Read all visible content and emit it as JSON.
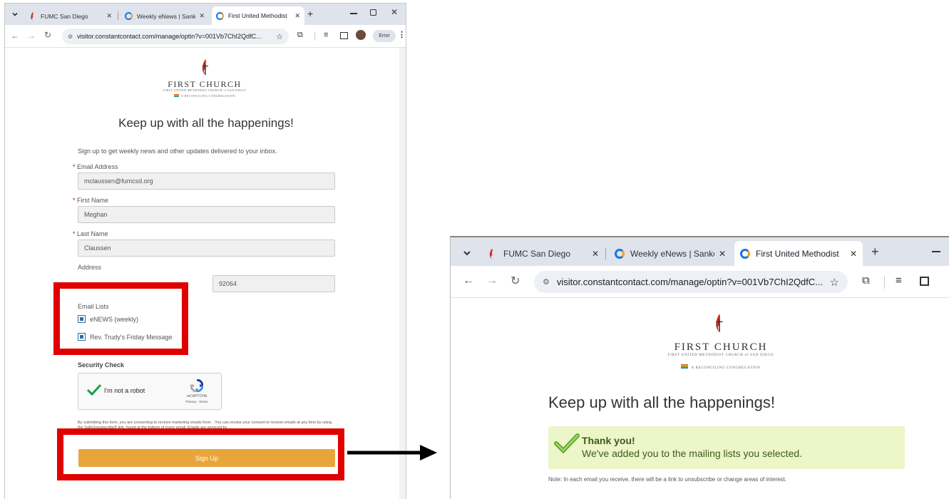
{
  "left_window": {
    "tabs": [
      {
        "title": "FUMC San Diego",
        "active": false
      },
      {
        "title": "Weekly eNews | Sankof",
        "active": false
      },
      {
        "title": "First United Methodist",
        "active": true
      }
    ],
    "new_tab": "+",
    "url": "visitor.constantcontact.com/manage/optin?v=001Vb7ChI2QdfC...",
    "error_badge": "Error",
    "logo": {
      "name": "FIRST CHURCH",
      "sub": "FIRST UNITED METHODIST CHURCH of SAN DIEGO",
      "tagline": "A RECONCILING CONGREGATION"
    },
    "heading": "Keep up with all the happenings!",
    "intro": "Sign up to get weekly news and other updates delivered to your inbox.",
    "fields": {
      "email": {
        "label": "Email Address",
        "value": "mclaussen@fumcsd.org"
      },
      "first_name": {
        "label": "First Name",
        "value": "Meghan"
      },
      "last_name": {
        "label": "Last Name",
        "value": "Claussen"
      },
      "address": {
        "label": "Address",
        "zip": "92064"
      }
    },
    "required_mark": "*",
    "email_lists": {
      "label": "Email Lists",
      "items": [
        "eNEWS (weekly)",
        "Rev. Trudy's Friday Message"
      ]
    },
    "security": {
      "label": "Security Check",
      "captcha_text": "I'm not a robot",
      "captcha_brand": "reCAPTCHA",
      "captcha_links": "Privacy - Terms"
    },
    "consent": "By submitting this form, you are consenting to receive marketing emails from: . You can revoke your consent to receive emails at any time by using the SafeUnsubscribe® link, found at the bottom of every email. Emails are serviced by",
    "signup_label": "Sign Up"
  },
  "right_window": {
    "tabs": [
      {
        "title": "FUMC San Diego",
        "active": false
      },
      {
        "title": "Weekly eNews | Sankof",
        "active": false
      },
      {
        "title": "First United Methodist",
        "active": true
      }
    ],
    "new_tab": "+",
    "url": "visitor.constantcontact.com/manage/optin?v=001Vb7ChI2QdfC...",
    "logo": {
      "name": "FIRST CHURCH",
      "sub": "FIRST UNITED METHODIST CHURCH of SAN DIEGO",
      "tagline": "A RECONCILING CONGREGATION"
    },
    "heading": "Keep up with all the happenings!",
    "thank_title": "Thank you!",
    "thank_msg": "We've added you to the mailing lists you selected.",
    "note": "Note: In each email you receive, there will be a link to unsubscribe or change areas of interest."
  },
  "colors": {
    "highlight": "#e00000",
    "signup_button": "#e8a63a",
    "success_bg": "#ecf6c8",
    "tab_strip": "#dfe3eb",
    "logo_red": "#cc2a1e"
  },
  "icons": [
    "chevron-down-icon",
    "close-icon",
    "back-icon",
    "forward-icon",
    "reload-icon",
    "site-info-icon",
    "star-icon",
    "extensions-icon",
    "reading-list-icon",
    "side-panel-icon",
    "profile-icon",
    "kebab-menu-icon",
    "checkmark-icon",
    "arrow-icon",
    "cross-flame-icon"
  ]
}
